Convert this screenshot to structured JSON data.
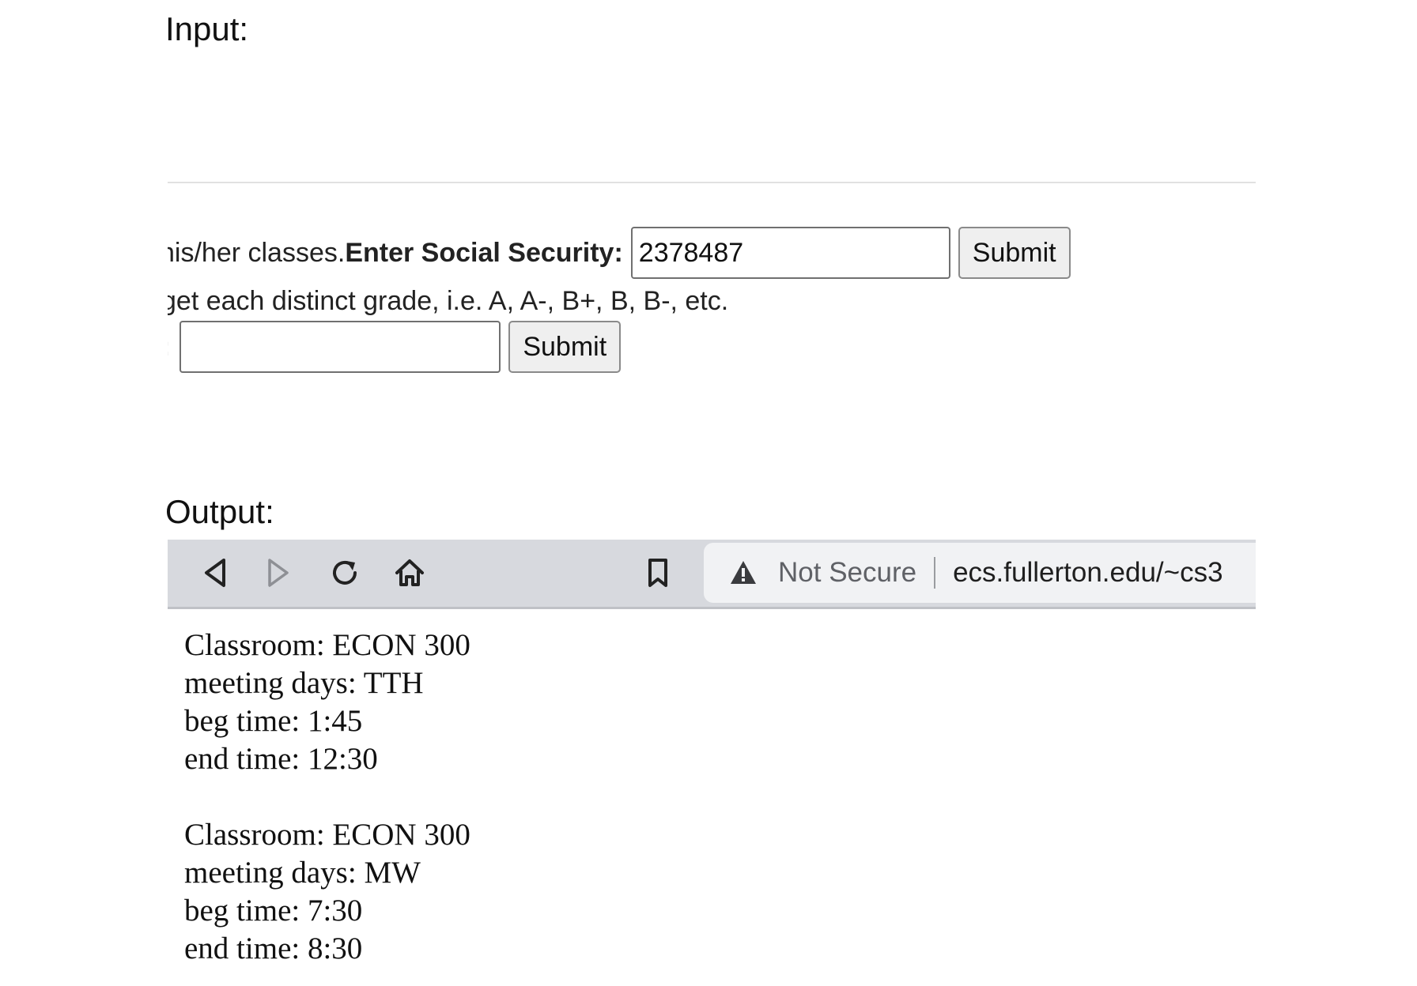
{
  "headings": {
    "input": "Input:",
    "output": "Output:"
  },
  "form": {
    "ssn_row": {
      "prefix_text": "nis/her classes. ",
      "label": "Enter Social Security:",
      "input_value": "2378487",
      "submit_label": "Submit"
    },
    "description_text": "get each distinct grade, i.e. A, A-, B+, B, B-, etc.",
    "grade_row": {
      "label": ":",
      "input_value": "",
      "submit_label": "Submit"
    }
  },
  "browser": {
    "toolbar": {
      "icons": [
        "back-icon",
        "forward-icon",
        "reload-icon",
        "home-icon",
        "bookmark-icon"
      ],
      "security_icon": "warning-icon",
      "security_label": "Not Secure",
      "url": "ecs.fullerton.edu/~cs3"
    },
    "records": [
      {
        "classroom": "Classroom: ECON 300",
        "meeting_days": "meeting days: TTH",
        "beg_time": "beg time: 1:45",
        "end_time": "end time: 12:30"
      },
      {
        "classroom": "Classroom: ECON 300",
        "meeting_days": "meeting days: MW",
        "beg_time": "beg time: 7:30",
        "end_time": "end time: 8:30"
      }
    ]
  },
  "colors": {
    "toolbar_bg": "#d7d9de",
    "address_bar_bg": "#f1f2f4",
    "button_bg": "#efefef",
    "not_secure_text": "#5f6166"
  }
}
